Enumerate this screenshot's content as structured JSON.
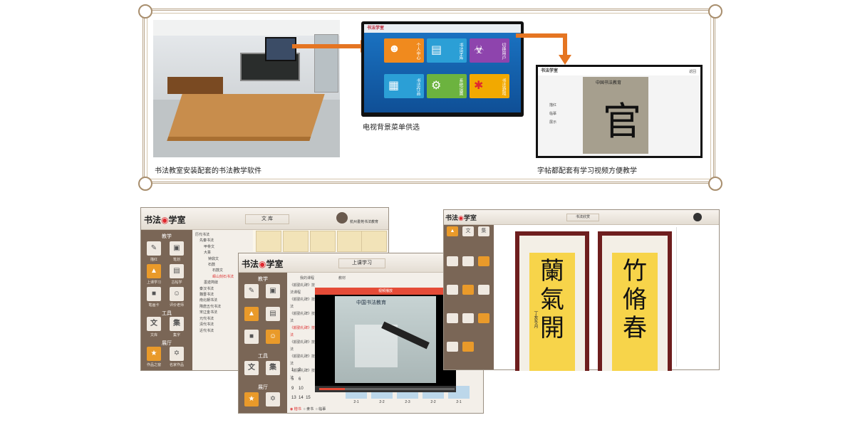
{
  "captions": {
    "classroom": "书法教室安装配套的书法教学软件",
    "tv_menu": "电视背景菜单供选",
    "copybook": "字帖都配套有学习视频方便教学"
  },
  "tv_menu": {
    "title": "书法学室",
    "tiles": [
      {
        "label": "个人中心",
        "icon": "user-icon",
        "color": "#f08a1e"
      },
      {
        "label": "书法字库",
        "icon": "book-icon",
        "color": "#2b9fd6"
      },
      {
        "label": "切换用户",
        "icon": "lock-icon",
        "color": "#8e44ad"
      },
      {
        "label": "书法作品",
        "icon": "calendar-icon",
        "color": "#2b9fd6"
      },
      {
        "label": "系统设置",
        "icon": "gear-icon",
        "color": "#6cb33f"
      },
      {
        "label": "书法游戏",
        "icon": "swirl-icon",
        "color": "#f2a900"
      }
    ]
  },
  "copybook": {
    "title": "书法学室",
    "close": "返回",
    "side_items": [
      "描红",
      "临摹",
      "展示"
    ],
    "banner": "中国书法教育",
    "char": "官"
  },
  "win1": {
    "logo_a": "书法",
    "logo_b": "学室",
    "title": "文 库",
    "user": "杭州書苑书法教育",
    "sections": [
      "教学",
      "工具",
      "展厅"
    ],
    "buttons": [
      "描红",
      "笔划",
      "上课学习",
      "古帖学",
      "笔画卡",
      "评价老师",
      "文库",
      "集字",
      "作品之窗",
      "名家作品"
    ],
    "tree": [
      "历代书法",
      "先秦书法",
      "甲骨文",
      "大篆",
      "钟鼎文",
      "石鼓",
      "石鼓文",
      "峄山刻石书法",
      "墨迹简牍",
      "秦汉书法",
      "魏晋书法",
      "南北朝书法",
      "隋唐五代书法",
      "宋辽金书法",
      "元代书法",
      "清代书法",
      "近代书法"
    ]
  },
  "win2": {
    "logo_a": "书法",
    "logo_b": "学室",
    "title": "上课学习",
    "list_header": "我的课程",
    "list_items": [
      "《颜勤礼碑》技法课程",
      "《颜勤礼碑》技法",
      "《颜勤礼碑》技法",
      "《颜勤礼碑》技法",
      "《颜勤礼碑》技法",
      "《颜勤礼碑》技法",
      "《颜勤礼碑》技法"
    ],
    "material": "教材",
    "video_title": "视频播放",
    "video_banner": "中国书法教育",
    "numbers": [
      "1",
      "2",
      "5",
      "6",
      "9",
      "10",
      "13",
      "14",
      "15"
    ],
    "page_labels": [
      "2-1",
      "2-2",
      "2-3",
      "2-2",
      "2-1"
    ],
    "footer": [
      "楷书",
      "隶书",
      "临摹"
    ]
  },
  "win3": {
    "title": "书法欣赏",
    "scroll_left": [
      "蘭",
      "氣",
      "開"
    ],
    "scroll_right": [
      "竹",
      "脩",
      "春"
    ],
    "scroll_side": "丁亥冬月"
  }
}
